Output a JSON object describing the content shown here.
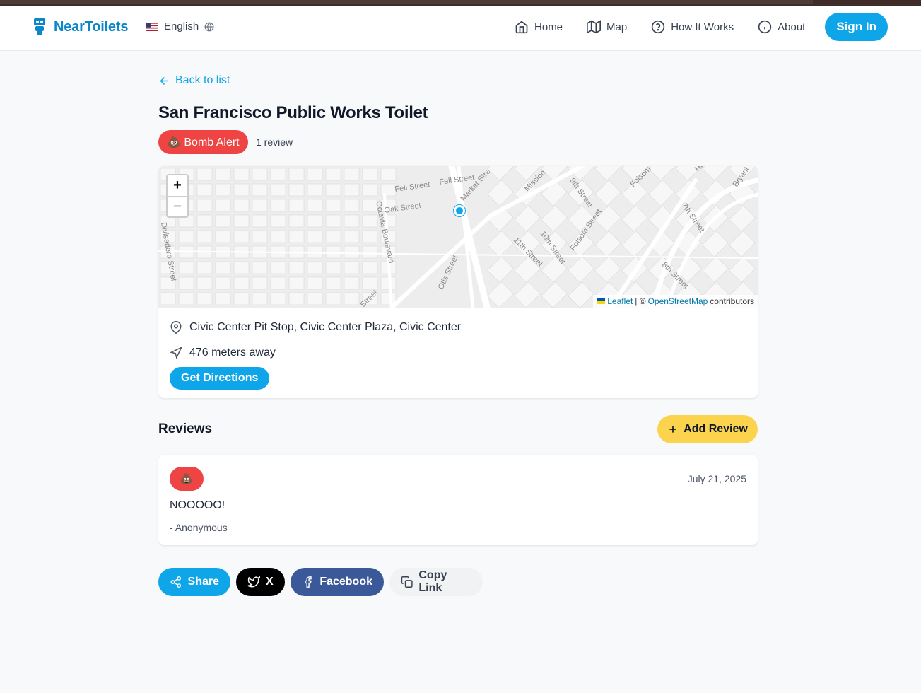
{
  "header": {
    "brand": "NearToilets",
    "language": "English",
    "nav": [
      {
        "label": "Home",
        "icon": "home-icon"
      },
      {
        "label": "Map",
        "icon": "map-icon"
      },
      {
        "label": "How It Works",
        "icon": "help-circle-icon"
      },
      {
        "label": "About",
        "icon": "info-icon"
      }
    ],
    "signin": "Sign In"
  },
  "page": {
    "back": "Back to list",
    "title": "San Francisco Public Works Toilet",
    "badge": "💩 Bomb Alert",
    "review_count": "1 review"
  },
  "map": {
    "zoom_in": "+",
    "zoom_out": "−",
    "attribution": {
      "leaflet": "Leaflet",
      "separator": "| ©",
      "osm": "OpenStreetMap",
      "suffix": "contributors"
    },
    "street_labels": [
      "Fell Street",
      "Fell Street",
      "Market Stre",
      "Oak Street",
      "Octavia Boulevard",
      "Mission",
      "9th Street",
      "Folsom",
      "Ha",
      "Bryant",
      "7th Street",
      "Folsom Street",
      "10th Street",
      "11th Street",
      "Otis Street",
      "8th Street",
      "Divisadero Street",
      "Street"
    ]
  },
  "location": {
    "address": "Civic Center Pit Stop, Civic Center Plaza, Civic Center",
    "distance": "476 meters away",
    "directions": "Get Directions"
  },
  "reviews": {
    "title": "Reviews",
    "add": "Add Review",
    "items": [
      {
        "badge": "💩",
        "date": "July 21, 2025",
        "text": "NOOOOO!",
        "author": "- Anonymous"
      }
    ]
  },
  "share": {
    "share": "Share",
    "x": "X",
    "facebook": "Facebook",
    "copy": "Copy Link"
  },
  "colors": {
    "accent": "#0ea5e9",
    "brand": "#0b86c9",
    "alert": "#ef4444",
    "add_review": "#fcd34d",
    "facebook": "#3b5998"
  }
}
